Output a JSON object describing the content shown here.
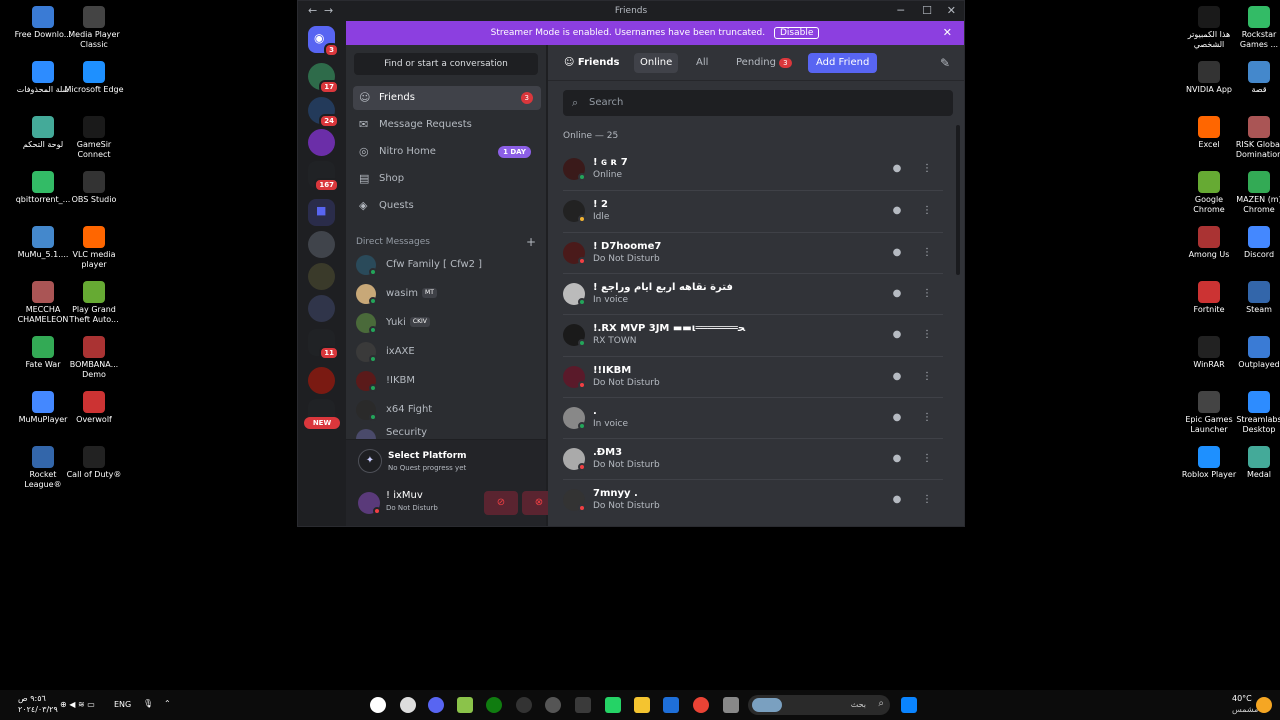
{
  "window": {
    "title": "Friends"
  },
  "banner": {
    "text": "Streamer Mode is enabled. Usernames have been truncated.",
    "disable_label": "Disable"
  },
  "guilds": {
    "home_badge": "3",
    "badges": [
      "17",
      "24",
      "167",
      "11"
    ],
    "new_label": "NEW"
  },
  "sidebar": {
    "find_label": "Find or start a conversation",
    "nav": [
      {
        "label": "Friends",
        "badge": "3"
      },
      {
        "label": "Message Requests"
      },
      {
        "label": "Nitro Home",
        "badge": "1 DAY"
      },
      {
        "label": "Shop"
      },
      {
        "label": "Quests"
      }
    ],
    "dm_header": "Direct Messages",
    "dms": [
      {
        "name": "Cfw Family [ Cfw2 ]"
      },
      {
        "name": "wasim",
        "tag": "MT"
      },
      {
        "name": "Yuki",
        "tag": "CKIV"
      },
      {
        "name": "ixAXE"
      },
      {
        "name": "!IKBM"
      },
      {
        "name": "x64 Fight"
      },
      {
        "name": "Security"
      }
    ],
    "quest": {
      "title": "Select Platform",
      "subtitle": "No Quest progress yet"
    },
    "user": {
      "name": "! ixMuv",
      "status": "Do Not Disturb"
    }
  },
  "main": {
    "tabs": {
      "friends": "Friends",
      "online": "Online",
      "all": "All",
      "pending": "Pending",
      "pending_badge": "3",
      "add_friend": "Add Friend"
    },
    "search_placeholder": "Search",
    "online_header": "Online — 25",
    "friends": [
      {
        "name": "! ɢ ʀ 7",
        "status": "Online",
        "color": "#23a55a"
      },
      {
        "name": "! 2",
        "status": "Idle",
        "color": "#f0b232"
      },
      {
        "name": "! D7hoome7",
        "status": "Do Not Disturb",
        "color": "#f23f43"
      },
      {
        "name": "! فترة نقاهه اربع ايام وراجع",
        "status": "In voice",
        "color": "#23a55a"
      },
      {
        "name": "!.RX MVP 3JM ▬▬ι═══════ﺤ",
        "status": "RX TOWN",
        "color": "#23a55a"
      },
      {
        "name": "!!IKBM",
        "status": "Do Not Disturb",
        "color": "#f23f43"
      },
      {
        "name": ".",
        "status": "In voice",
        "color": "#23a55a"
      },
      {
        "name": ".ƉM3",
        "status": "Do Not Disturb",
        "color": "#f23f43"
      },
      {
        "name": "7mnyy .",
        "status": "Do Not Disturb",
        "color": "#f23f43"
      }
    ]
  },
  "desktop": {
    "left": [
      "Free Downlo...",
      "Media Player Classic",
      "سلة المحذوفات",
      "Microsoft Edge",
      "لوحة التحكم",
      "GameSir Connect",
      "qbittorrent_...",
      "OBS Studio",
      "MuMu_5.1....",
      "VLC media player",
      "MECCHA CHAMELEON",
      "Play Grand Theft Auto...",
      "Fate War",
      "BOMBANA... Demo",
      "MuMuPlayer",
      "Overwolf",
      "Rocket League®",
      "Call of Duty®"
    ],
    "right": [
      "هذا الكمبيوتر الشخصي",
      "Rockstar Games ...",
      "NVIDIA App",
      "قصة",
      "Excel",
      "RISK Global Domination",
      "Google Chrome",
      "MAZEN (m) Chrome",
      "Among Us",
      "Discord",
      "Fortnite",
      "Steam",
      "WinRAR",
      "Outplayed",
      "Epic Games Launcher",
      "Streamlabs Desktop",
      "Roblox Player",
      "Medal"
    ]
  },
  "taskbar": {
    "time": "٩:٥٦ ص",
    "date": "٢٠٢٤/٠٣/٢٩",
    "lang": "ENG",
    "search": "بحث",
    "weather": "40°C",
    "weather_desc": "مشمس"
  }
}
